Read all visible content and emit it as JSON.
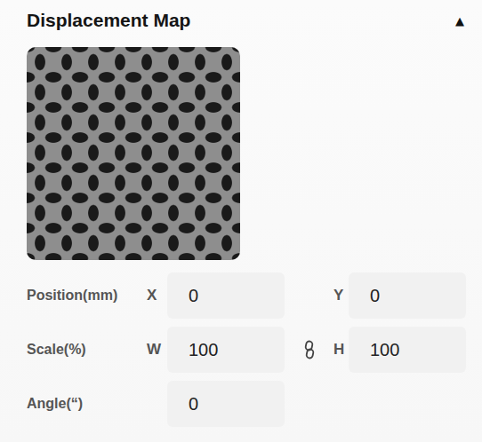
{
  "panel": {
    "title": "Displacement Map",
    "toggle": "▲",
    "expanded": true
  },
  "rows": [
    {
      "label": "Position(mm)",
      "kind": "pair",
      "fields": [
        {
          "axis": "X",
          "value": "0"
        },
        {
          "axis": "Y",
          "value": "0"
        }
      ]
    },
    {
      "label": "Scale(%)",
      "kind": "linked",
      "fields": [
        {
          "axis": "W",
          "value": "100"
        },
        {
          "axis": "H",
          "value": "100"
        }
      ]
    },
    {
      "label": "Angle(“)",
      "kind": "single",
      "fields": [
        {
          "axis": "",
          "value": "0"
        }
      ]
    }
  ]
}
